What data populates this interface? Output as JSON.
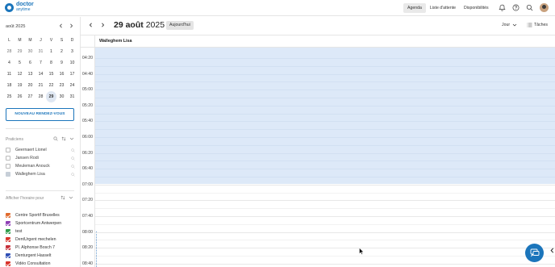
{
  "brand": {
    "word1": "doctor",
    "word2": "anytime"
  },
  "nav": [
    {
      "label": "Agenda",
      "active": true
    },
    {
      "label": "Liste d'attente",
      "active": false
    },
    {
      "label": "Disponibilités",
      "active": false
    }
  ],
  "top_icons": [
    "bell-icon",
    "help-icon",
    "search-icon",
    "user-avatar"
  ],
  "mini_calendar": {
    "month_label": "août 2025",
    "weekdays": [
      "L",
      "M",
      "M",
      "J",
      "V",
      "S",
      "D"
    ],
    "weeks": [
      [
        "28",
        "29",
        "30",
        "31",
        "1",
        "2",
        "3"
      ],
      [
        "4",
        "5",
        "6",
        "7",
        "8",
        "9",
        "10"
      ],
      [
        "11",
        "12",
        "13",
        "14",
        "15",
        "16",
        "17"
      ],
      [
        "18",
        "19",
        "20",
        "21",
        "22",
        "23",
        "24"
      ],
      [
        "25",
        "26",
        "27",
        "28",
        "29",
        "30",
        "31"
      ]
    ],
    "selected": "29"
  },
  "new_appointment_label": "NOUVEAU RENDEZ-VOUS",
  "practitioners": {
    "title": "Praticiens",
    "items": [
      {
        "name": "Geernaert Lionel",
        "checked": false
      },
      {
        "name": "Jansen Rodi",
        "checked": false
      },
      {
        "name": "Meuleman Anouck",
        "checked": false
      },
      {
        "name": "Walleghem Lisa",
        "checked": true
      }
    ]
  },
  "locations": {
    "title": "Afficher l'horaire pour",
    "items": [
      {
        "name": "Centre Sportif Bruxelles",
        "color": "#e06a2c"
      },
      {
        "name": "Sportcentrum Antwerpen",
        "color": "#8e3fb5"
      },
      {
        "name": "test",
        "color": "#2e9c4a"
      },
      {
        "name": "DentUrgent mechelen",
        "color": "#d9342b"
      },
      {
        "name": "Pl. Alphonse Bosch 7",
        "color": "#c6303a"
      },
      {
        "name": "Denturgent Hasselt",
        "color": "#2f4fb5"
      },
      {
        "name": "Vidéo Consultation",
        "color": "#d9342b"
      }
    ]
  },
  "header": {
    "date_day": "29 août",
    "date_year": "2025",
    "today_label": "Aujourd'hui",
    "view_label": "Jour",
    "tasks_label": "Tâches"
  },
  "resource": {
    "name": "Walleghem Lisa"
  },
  "times": [
    "04:20",
    "04:40",
    "05:00",
    "05:20",
    "05:40",
    "06:00",
    "06:20",
    "06:40",
    "07:00",
    "07:20",
    "07:40",
    "08:00",
    "08:20",
    "08:40"
  ],
  "colors": {
    "accent": "#1b75bb",
    "blocked": "#dde9f8"
  }
}
